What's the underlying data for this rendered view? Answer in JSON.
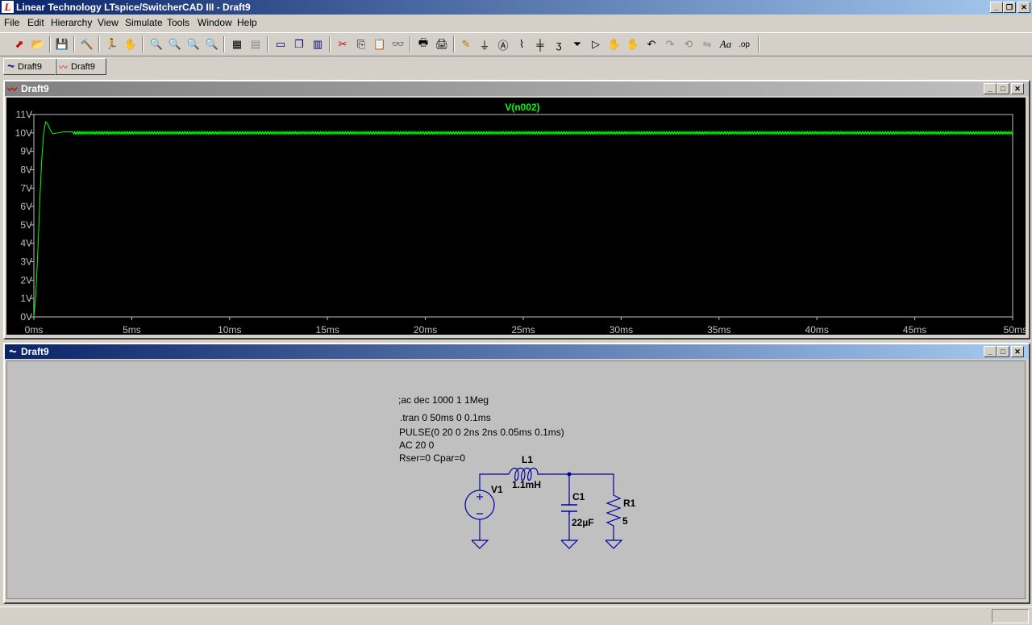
{
  "window": {
    "title": "Linear Technology LTspice/SwitcherCAD III - Draft9",
    "app_icon": "ltspice-logo-icon"
  },
  "menu": [
    "File",
    "Edit",
    "Hierarchy",
    "View",
    "Simulate",
    "Tools",
    "Window",
    "Help"
  ],
  "tabs": [
    {
      "label": "Draft9",
      "icon": "schematic-icon"
    },
    {
      "label": "Draft9",
      "icon": "waveform-icon"
    }
  ],
  "plot_window": {
    "title": "Draft9",
    "trace_label": "V(n002)",
    "trace_color": "#00ff00",
    "axis_color": "#c0c0c0"
  },
  "chart_data": {
    "type": "line",
    "title": "V(n002)",
    "xlabel": "",
    "ylabel": "",
    "x_ticks": [
      "0ms",
      "5ms",
      "10ms",
      "15ms",
      "20ms",
      "25ms",
      "30ms",
      "35ms",
      "40ms",
      "45ms",
      "50ms"
    ],
    "y_ticks": [
      "0V",
      "1V",
      "2V",
      "3V",
      "4V",
      "5V",
      "6V",
      "7V",
      "8V",
      "9V",
      "10V",
      "11V"
    ],
    "xlim": [
      0,
      50
    ],
    "ylim": [
      0,
      11
    ],
    "series": [
      {
        "name": "V(n002)",
        "x": [
          0,
          0.1,
          0.2,
          0.3,
          0.4,
          0.5,
          0.6,
          0.7,
          0.8,
          0.9,
          1.0,
          1.2,
          1.5,
          2.0,
          3.0,
          5.0,
          10.0,
          20.0,
          30.0,
          40.0,
          50.0
        ],
        "y": [
          0,
          1.2,
          3.5,
          6.2,
          8.5,
          10.0,
          10.6,
          10.5,
          10.25,
          10.05,
          9.95,
          10.0,
          10.05,
          10.0,
          10.0,
          10.0,
          10.0,
          10.0,
          10.0,
          10.0,
          10.0
        ],
        "ripple": 0.1
      }
    ],
    "grid": false,
    "legend": "top-center"
  },
  "schematic_window": {
    "title": "Draft9",
    "directives": [
      ";ac dec 1000 1 1Meg",
      ".tran 0 50ms 0 0.1ms"
    ],
    "source_params": [
      "PULSE(0 20 0 2ns 2ns 0.05ms 0.1ms)",
      "AC 20 0",
      "Rser=0 Cpar=0"
    ],
    "components": {
      "v1": {
        "name": "V1"
      },
      "l1": {
        "name": "L1",
        "value": "1.1mH"
      },
      "c1": {
        "name": "C1",
        "value": "22µF"
      },
      "r1": {
        "name": "R1",
        "value": "5"
      }
    },
    "wire_color": "#0000a0"
  }
}
